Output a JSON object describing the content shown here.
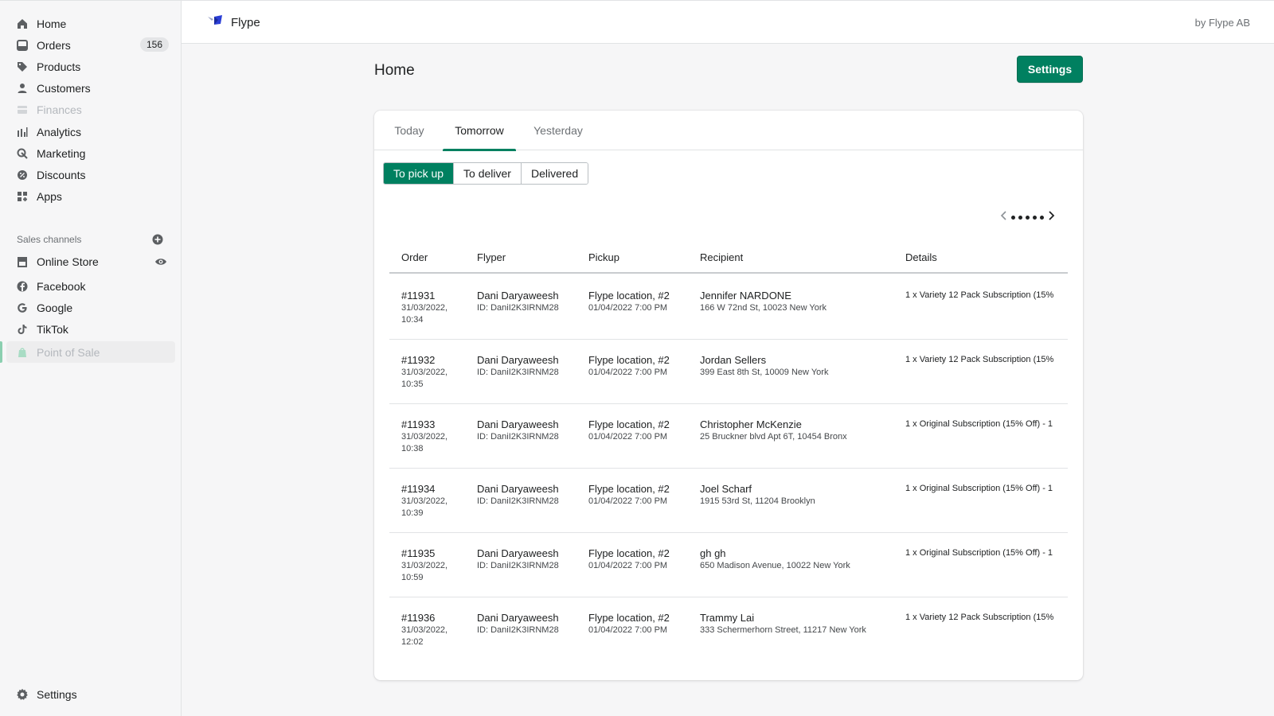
{
  "sidebar": {
    "items": [
      {
        "label": "Home",
        "icon": "home-icon"
      },
      {
        "label": "Orders",
        "icon": "orders-icon",
        "badge": "156"
      },
      {
        "label": "Products",
        "icon": "tag-icon"
      },
      {
        "label": "Customers",
        "icon": "person-icon"
      },
      {
        "label": "Finances",
        "icon": "finances-icon"
      },
      {
        "label": "Analytics",
        "icon": "bar-chart-icon"
      },
      {
        "label": "Marketing",
        "icon": "marketing-icon"
      },
      {
        "label": "Discounts",
        "icon": "discount-icon"
      },
      {
        "label": "Apps",
        "icon": "apps-icon"
      }
    ],
    "sales_channels_label": "Sales channels",
    "channels": [
      {
        "label": "Online Store",
        "icon": "store-icon"
      },
      {
        "label": "Facebook",
        "icon": "facebook-icon"
      },
      {
        "label": "Google",
        "icon": "google-icon"
      },
      {
        "label": "TikTok",
        "icon": "tiktok-icon"
      },
      {
        "label": "Point of Sale",
        "icon": "pos-icon"
      }
    ],
    "settings_label": "Settings"
  },
  "topbar": {
    "app_name": "Flype",
    "byline": "by Flype AB"
  },
  "page": {
    "title": "Home",
    "settings_button": "Settings"
  },
  "tabs": [
    "Today",
    "Tomorrow",
    "Yesterday"
  ],
  "active_tab": "Tomorrow",
  "segments": [
    "To pick up",
    "To deliver",
    "Delivered"
  ],
  "active_segment": "To pick up",
  "table": {
    "headers": [
      "Order",
      "Flyper",
      "Pickup",
      "Recipient",
      "Details"
    ],
    "rows": [
      {
        "order": "#11931",
        "date": "31/03/2022,",
        "time": "10:34",
        "flyper": "Dani Daryaweesh",
        "flyper_id": "ID: DaniI2K3IRNM28",
        "pickup": "Flype location, #2",
        "pickup_time": "01/04/2022 7:00 PM",
        "recipient": "Jennifer NARDONE",
        "address": "166 W 72nd St, 10023 New York",
        "details": "1 x Variety 12 Pack Subscription (15%"
      },
      {
        "order": "#11932",
        "date": "31/03/2022,",
        "time": "10:35",
        "flyper": "Dani Daryaweesh",
        "flyper_id": "ID: DaniI2K3IRNM28",
        "pickup": "Flype location, #2",
        "pickup_time": "01/04/2022 7:00 PM",
        "recipient": "Jordan Sellers",
        "address": "399 East 8th St, 10009 New York",
        "details": "1 x Variety 12 Pack Subscription (15%"
      },
      {
        "order": "#11933",
        "date": "31/03/2022,",
        "time": "10:38",
        "flyper": "Dani Daryaweesh",
        "flyper_id": "ID: DaniI2K3IRNM28",
        "pickup": "Flype location, #2",
        "pickup_time": "01/04/2022 7:00 PM",
        "recipient": "Christopher McKenzie",
        "address": "25 Bruckner blvd Apt 6T, 10454 Bronx",
        "details": "1 x Original Subscription (15% Off) - 1"
      },
      {
        "order": "#11934",
        "date": "31/03/2022,",
        "time": "10:39",
        "flyper": "Dani Daryaweesh",
        "flyper_id": "ID: DaniI2K3IRNM28",
        "pickup": "Flype location, #2",
        "pickup_time": "01/04/2022 7:00 PM",
        "recipient": "Joel Scharf",
        "address": "1915 53rd St, 11204 Brooklyn",
        "details": "1 x Original Subscription (15% Off) - 1"
      },
      {
        "order": "#11935",
        "date": "31/03/2022,",
        "time": "10:59",
        "flyper": "Dani Daryaweesh",
        "flyper_id": "ID: DaniI2K3IRNM28",
        "pickup": "Flype location, #2",
        "pickup_time": "01/04/2022 7:00 PM",
        "recipient": "gh gh",
        "address": "650 Madison Avenue, 10022 New York",
        "details": "1 x Original Subscription (15% Off) - 1"
      },
      {
        "order": "#11936",
        "date": "31/03/2022,",
        "time": "12:02",
        "flyper": "Dani Daryaweesh",
        "flyper_id": "ID: DaniI2K3IRNM28",
        "pickup": "Flype location, #2",
        "pickup_time": "01/04/2022 7:00 PM",
        "recipient": "Trammy Lai",
        "address": "333 Schermerhorn Street, 11217 New York",
        "details": "1 x Variety 12 Pack Subscription (15%"
      }
    ]
  },
  "colors": {
    "accent": "#008060",
    "sidebar_bg": "#f6f6f7",
    "text": "#202223",
    "muted": "#6d7175"
  }
}
